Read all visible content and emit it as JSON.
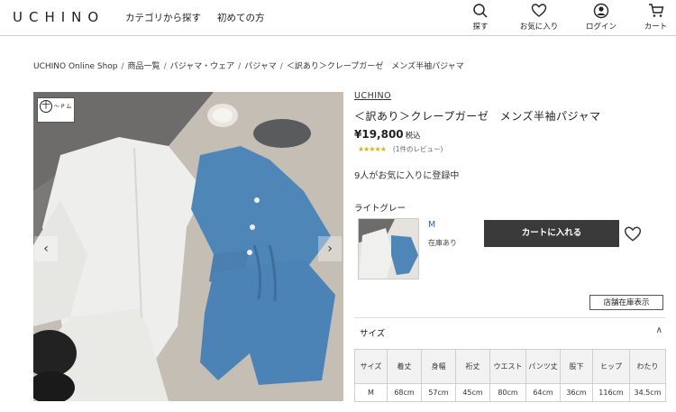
{
  "header": {
    "logo": "UCHINO",
    "nav": {
      "category": "カテゴリから探す",
      "first_time": "初めての方"
    },
    "icons": {
      "search": "探す",
      "favorites": "お気に入り",
      "login": "ログイン",
      "cart": "カート"
    }
  },
  "breadcrumb": [
    "UCHINO Online Shop",
    "商品一覧",
    "パジャマ・ウェア",
    "パジャマ",
    "＜訳あり＞クレープガーゼ　メンズ半袖パジャマ"
  ],
  "badge": {
    "text": "〜 P ム",
    "num": "十"
  },
  "product": {
    "brand": "UCHINO",
    "title": "＜訳あり＞クレープガーゼ　メンズ半袖パジャマ",
    "price": "¥19,800",
    "tax": "税込",
    "stars": "★★★★★",
    "rating_value": 5,
    "reviews": "(1件のレビュー)",
    "fav_count": "9人がお気に入りに登録中",
    "color_name": "ライトグレー",
    "size": "M",
    "stock": "在庫あり",
    "cart_button": "カートに入れる",
    "store_stock_button": "店舗在庫表示"
  },
  "size_section": {
    "title": "サイズ",
    "chevron": "∧",
    "headers": [
      "サイズ",
      "着丈",
      "身幅",
      "裄丈",
      "ウエスト",
      "パンツ丈",
      "股下",
      "ヒップ",
      "わたり"
    ],
    "rows": [
      [
        "M",
        "68cm",
        "57cm",
        "45cm",
        "80cm",
        "64cm",
        "36cm",
        "116cm",
        "34.5cm"
      ]
    ]
  },
  "colors": {
    "cart_button_bg": "#3a3a3a",
    "star": "#d9b31a",
    "link_blue": "#2a5fb8",
    "pajama_blue": "#4f86b8",
    "pajama_white": "#eeeeec"
  },
  "nav_arrows": {
    "prev": "‹",
    "next": "›"
  }
}
